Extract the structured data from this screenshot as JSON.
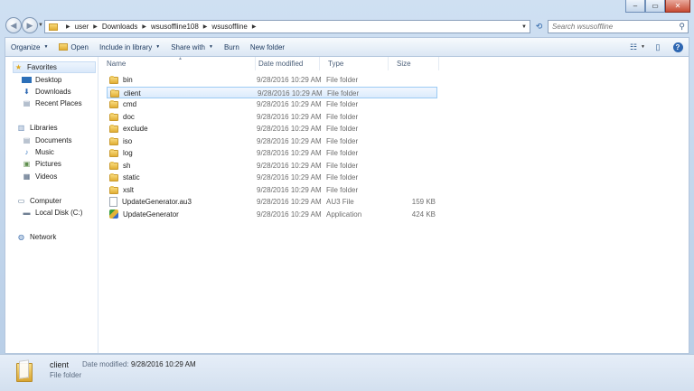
{
  "window": {
    "controls": {
      "minimize": "–",
      "maximize": "▭",
      "close": "✕"
    }
  },
  "address_bar": {
    "breadcrumbs": [
      "user",
      "Downloads",
      "wsusoffline108",
      "wsusoffline"
    ]
  },
  "search": {
    "placeholder": "Search wsusoffline"
  },
  "toolbar": {
    "organize": "Organize",
    "open": "Open",
    "include_in_library": "Include in library",
    "share_with": "Share with",
    "burn": "Burn",
    "new_folder": "New folder"
  },
  "nav_pane": {
    "favorites": {
      "label": "Favorites",
      "items": [
        "Desktop",
        "Downloads",
        "Recent Places"
      ]
    },
    "libraries": {
      "label": "Libraries",
      "items": [
        "Documents",
        "Music",
        "Pictures",
        "Videos"
      ]
    },
    "computer": {
      "label": "Computer",
      "items": [
        "Local Disk (C:)"
      ]
    },
    "network": {
      "label": "Network"
    }
  },
  "file_list": {
    "columns": [
      "Name",
      "Date modified",
      "Type",
      "Size"
    ],
    "rows": [
      {
        "name": "bin",
        "date": "9/28/2016 10:29 AM",
        "type": "File folder",
        "size": "",
        "icon": "folder-icon"
      },
      {
        "name": "client",
        "date": "9/28/2016 10:29 AM",
        "type": "File folder",
        "size": "",
        "icon": "folder-icon",
        "selected": true
      },
      {
        "name": "cmd",
        "date": "9/28/2016 10:29 AM",
        "type": "File folder",
        "size": "",
        "icon": "folder-icon"
      },
      {
        "name": "doc",
        "date": "9/28/2016 10:29 AM",
        "type": "File folder",
        "size": "",
        "icon": "folder-icon"
      },
      {
        "name": "exclude",
        "date": "9/28/2016 10:29 AM",
        "type": "File folder",
        "size": "",
        "icon": "folder-icon"
      },
      {
        "name": "iso",
        "date": "9/28/2016 10:29 AM",
        "type": "File folder",
        "size": "",
        "icon": "folder-icon"
      },
      {
        "name": "log",
        "date": "9/28/2016 10:29 AM",
        "type": "File folder",
        "size": "",
        "icon": "folder-icon"
      },
      {
        "name": "sh",
        "date": "9/28/2016 10:29 AM",
        "type": "File folder",
        "size": "",
        "icon": "folder-icon"
      },
      {
        "name": "static",
        "date": "9/28/2016 10:29 AM",
        "type": "File folder",
        "size": "",
        "icon": "folder-icon"
      },
      {
        "name": "xslt",
        "date": "9/28/2016 10:29 AM",
        "type": "File folder",
        "size": "",
        "icon": "folder-icon"
      },
      {
        "name": "UpdateGenerator.au3",
        "date": "9/28/2016 10:29 AM",
        "type": "AU3 File",
        "size": "159 KB",
        "icon": "file-icon"
      },
      {
        "name": "UpdateGenerator",
        "date": "9/28/2016 10:29 AM",
        "type": "Application",
        "size": "424 KB",
        "icon": "app-icon"
      }
    ]
  },
  "details_pane": {
    "name": "client",
    "date_label": "Date modified:",
    "date_value": "9/28/2016 10:29 AM",
    "type": "File folder"
  },
  "colors": {
    "selection_fill": "#dcebfc",
    "selection_border": "#9ccbf4",
    "frame": "#c9dcef"
  }
}
